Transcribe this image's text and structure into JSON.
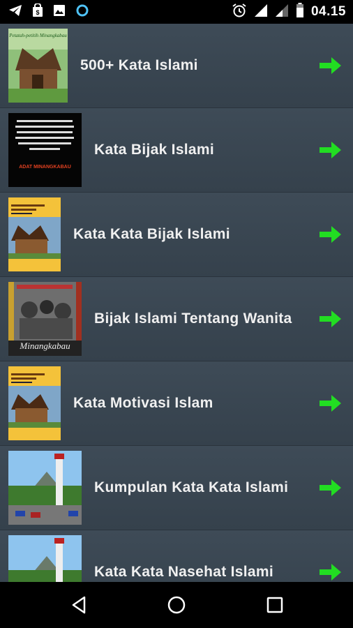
{
  "status_bar": {
    "time": "04.15",
    "left_icons": [
      "telegram-icon",
      "shopping-bag-icon",
      "image-icon",
      "circle-app-icon"
    ],
    "right_icons": [
      "alarm-icon",
      "signal-icon",
      "signal-weak-icon",
      "battery-icon"
    ]
  },
  "list": {
    "items": [
      {
        "title": "500+ Kata Islami",
        "thumb_text": "Petatah-petitih Minangkabau"
      },
      {
        "title": "Kata Bijak Islami",
        "thumb_text": "ADAT MINANGKABAU"
      },
      {
        "title": "Kata Kata Bijak Islami",
        "thumb_text": ""
      },
      {
        "title": "Bijak Islami Tentang Wanita",
        "thumb_text": "Minangkabau"
      },
      {
        "title": "Kata Motivasi Islam",
        "thumb_text": ""
      },
      {
        "title": "Kumpulan Kata Kata Islami",
        "thumb_text": ""
      },
      {
        "title": "Kata Kata Nasehat Islami",
        "thumb_text": ""
      }
    ]
  },
  "nav_bar": {
    "buttons": [
      "back-icon",
      "home-icon",
      "recents-icon"
    ]
  },
  "colors": {
    "arrow": "#22dd22",
    "row_background": "#3a4652",
    "text": "#f0f0f0"
  }
}
